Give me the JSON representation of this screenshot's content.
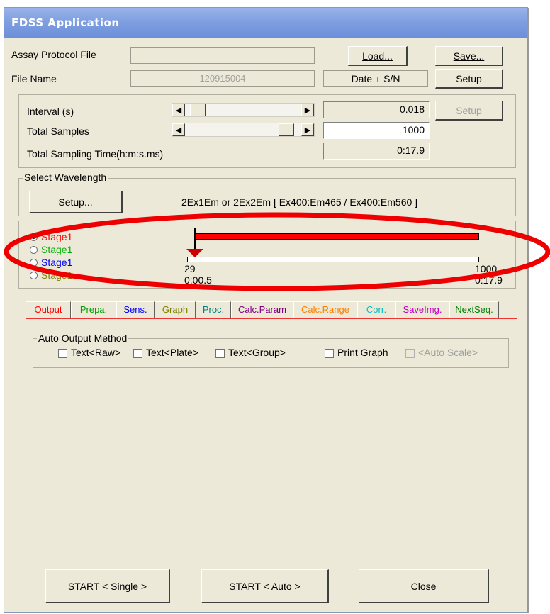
{
  "window": {
    "title": "FDSS Application"
  },
  "file": {
    "assay_label": "Assay Protocol File",
    "assay_value": "",
    "filename_label": "File Name",
    "filename_value": "120915004",
    "date_sn": "Date + S/N",
    "load_label": "Load...",
    "save_label": "Save...",
    "setup_label": "Setup"
  },
  "sampling": {
    "interval_label": "Interval (s)",
    "interval_value": "0.018",
    "interval_fraction": 0.05,
    "total_samples_label": "Total Samples",
    "total_samples_value": "1000",
    "total_samples_fraction": 0.92,
    "total_time_label": "Total Sampling Time(h:m:s.ms)",
    "total_time_value": "0:17.9",
    "setup_label": "Setup"
  },
  "wavelength": {
    "group_label": "Select Wavelength",
    "setup_label": "Setup...",
    "description": "2Ex1Em or 2Ex2Em [ Ex400:Em465 / Ex400:Em560 ]"
  },
  "stages": {
    "items": [
      {
        "label": "Stage1",
        "color": "#ff0000",
        "selected": true
      },
      {
        "label": "Stage1",
        "color": "#00b000",
        "selected": false
      },
      {
        "label": "Stage1",
        "color": "#0000ff",
        "selected": false
      },
      {
        "label": "Stage1",
        "color": "#808000",
        "selected": false
      }
    ],
    "start_count": "29",
    "start_time": "0:00.5",
    "end_count": "1000",
    "end_time": "0:17.9",
    "bar_color": "#ff0000"
  },
  "tabs": [
    {
      "label": "Output",
      "color": "#ff0000",
      "active": true
    },
    {
      "label": "Prepa.",
      "color": "#00a000"
    },
    {
      "label": "Sens.",
      "color": "#0000ff"
    },
    {
      "label": "Graph",
      "color": "#808000"
    },
    {
      "label": "Proc.",
      "color": "#008080"
    },
    {
      "label": "Calc.Param",
      "color": "#800080"
    },
    {
      "label": "Calc.Range",
      "color": "#ff8000"
    },
    {
      "label": "Corr.",
      "color": "#00c0c0"
    },
    {
      "label": "SaveImg.",
      "color": "#c000c0"
    },
    {
      "label": "NextSeq.",
      "color": "#008000"
    }
  ],
  "output": {
    "group_label": "Auto Output Method",
    "options": [
      {
        "label": "Text<Raw>",
        "checked": false,
        "enabled": true
      },
      {
        "label": "Text<Plate>",
        "checked": false,
        "enabled": true
      },
      {
        "label": "Text<Group>",
        "checked": false,
        "enabled": true
      },
      {
        "label": "Print Graph",
        "checked": false,
        "enabled": true
      },
      {
        "label": "<Auto Scale>",
        "checked": false,
        "enabled": false
      }
    ]
  },
  "footer": {
    "start_single": "START < Single >",
    "start_auto": "START < Auto >",
    "close": "Close"
  },
  "annotation": {
    "color": "#ee0000"
  }
}
